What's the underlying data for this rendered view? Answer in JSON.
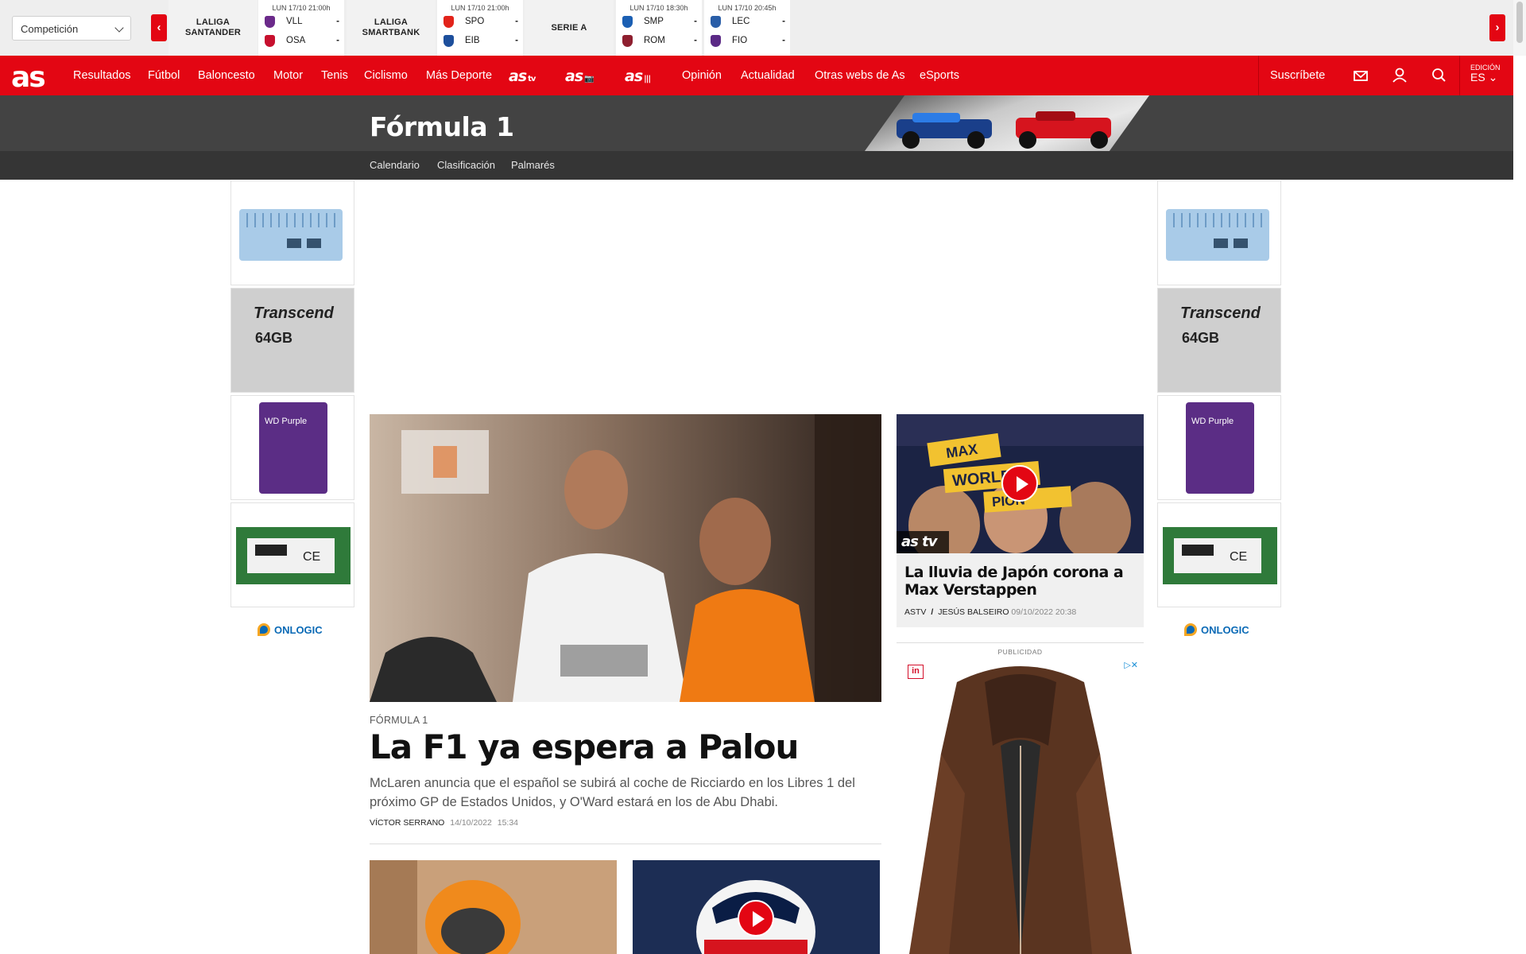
{
  "scorebar": {
    "competition_select": "Competición",
    "prev_arrow": "‹",
    "next_arrow": "›",
    "competitions": [
      {
        "name_line1": "LALIGA",
        "name_line2": "SANTANDER",
        "matches": [
          {
            "datetime": "LUN 17/10 21:00h",
            "home": "VLL",
            "away": "OSA",
            "home_score": "-",
            "away_score": "-",
            "home_color": "#6b2a8a",
            "away_color": "#c7102e"
          }
        ]
      },
      {
        "name_line1": "LALIGA",
        "name_line2": "SMARTBANK",
        "matches": [
          {
            "datetime": "LUN 17/10 21:00h",
            "home": "SPO",
            "away": "EIB",
            "home_score": "-",
            "away_score": "-",
            "home_color": "#e2231a",
            "away_color": "#1d4f9c"
          }
        ]
      },
      {
        "name_line1": "SERIE A",
        "name_line2": "",
        "matches": [
          {
            "datetime": "LUN 17/10 18:30h",
            "home": "SMP",
            "away": "ROM",
            "home_score": "-",
            "away_score": "-",
            "home_color": "#1b5fb3",
            "away_color": "#8e1f2f"
          },
          {
            "datetime": "LUN 17/10 20:45h",
            "home": "LEC",
            "away": "FIO",
            "home_score": "-",
            "away_score": "-",
            "home_color": "#2a5ea8",
            "away_color": "#5b2a86"
          }
        ]
      }
    ]
  },
  "nav": {
    "logo": "as",
    "items": [
      "Resultados",
      "Fútbol",
      "Baloncesto",
      "Motor",
      "Tenis",
      "Ciclismo",
      "Más Deporte"
    ],
    "brands": [
      {
        "text": "as",
        "suffix": "tv"
      },
      {
        "text": "as",
        "suffix": "📷"
      },
      {
        "text": "as",
        "suffix": "|||"
      }
    ],
    "items_after": [
      "Opinión",
      "Actualidad",
      "Otras webs de As",
      "eSports"
    ],
    "subscribe": "Suscríbete",
    "edition_label": "EDICIÓN",
    "edition_value": "ES"
  },
  "section": {
    "title": "Fórmula 1",
    "subnav": [
      "Calendario",
      "Clasificación",
      "Palmarés"
    ]
  },
  "ads": {
    "sky_products": [
      "Transcend",
      "64GB",
      "WD Purple"
    ],
    "sky_brand": "ONLOGIC",
    "publicidad_label": "PUBLICIDAD",
    "pub_badge": "in"
  },
  "lead": {
    "kicker": "FÓRMULA 1",
    "headline": "La F1 ya espera a Palou",
    "standfirst": "McLaren anuncia que el español se subirá al coche de Ricciardo en los Libres 1 del próximo GP de Estados Unidos, y O'Ward estará en los de Abu Dhabi.",
    "author": "VÍCTOR SERRANO",
    "date": "14/10/2022",
    "time": "15:34"
  },
  "side": {
    "badge": "as tv",
    "title": "La lluvia de Japón corona a Max Verstappen",
    "section": "ASTV",
    "author": "JESÚS BALSEIRO",
    "date": "09/10/2022",
    "time": "20:38",
    "image_words": [
      "MAX",
      "WORLD",
      "PION"
    ]
  }
}
